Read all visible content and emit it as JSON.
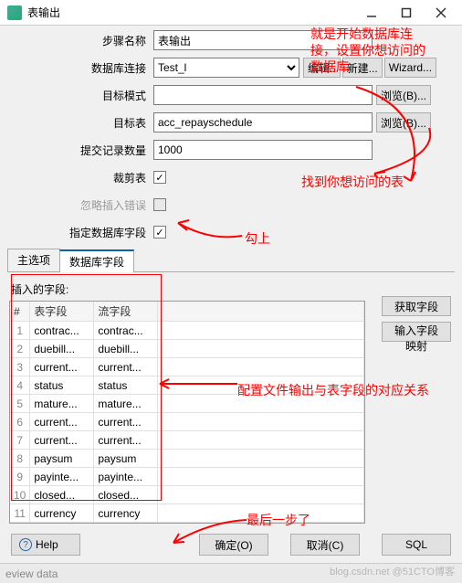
{
  "window": {
    "title": "表输出"
  },
  "form": {
    "stepName": {
      "label": "步骤名称",
      "value": "表输出"
    },
    "dbConn": {
      "label": "数据库连接",
      "value": "Test_l",
      "editBtn": "编辑..",
      "newBtn": "新建...",
      "wizardBtn": "Wizard..."
    },
    "targetSchema": {
      "label": "目标模式",
      "value": "",
      "browseBtn": "浏览(B)..."
    },
    "targetTable": {
      "label": "目标表",
      "value": "acc_repayschedule",
      "browseBtn": "浏览(B)..."
    },
    "commitSize": {
      "label": "提交记录数量",
      "value": "1000"
    },
    "truncate": {
      "label": "裁剪表",
      "checked": true
    },
    "ignoreErr": {
      "label": "忽略插入错误",
      "checked": false
    },
    "specifyFields": {
      "label": "指定数据库字段",
      "checked": true
    }
  },
  "tabs": {
    "main": "主选项",
    "fields": "数据库字段"
  },
  "fieldsPanel": {
    "insertLabel": "插入的字段:",
    "getFieldsBtn": "获取字段",
    "mapBtn": "输入字段映射",
    "columns": {
      "num": "#",
      "tableField": "表字段",
      "streamField": "流字段"
    },
    "rows": [
      {
        "n": 1,
        "t": "contrac...",
        "s": "contrac..."
      },
      {
        "n": 2,
        "t": "duebill...",
        "s": "duebill..."
      },
      {
        "n": 3,
        "t": "current...",
        "s": "current..."
      },
      {
        "n": 4,
        "t": "status",
        "s": "status"
      },
      {
        "n": 5,
        "t": "mature...",
        "s": "mature..."
      },
      {
        "n": 6,
        "t": "current...",
        "s": "current..."
      },
      {
        "n": 7,
        "t": "current...",
        "s": "current..."
      },
      {
        "n": 8,
        "t": "paysum",
        "s": "paysum"
      },
      {
        "n": 9,
        "t": "payinte...",
        "s": "payinte..."
      },
      {
        "n": 10,
        "t": "closed...",
        "s": "closed..."
      },
      {
        "n": 11,
        "t": "currency",
        "s": "currency"
      }
    ]
  },
  "buttons": {
    "help": "Help",
    "ok": "确定(O)",
    "cancel": "取消(C)",
    "sql": "SQL"
  },
  "annotations": {
    "a1": "就是开始数据库连\n接，设置你想访问的\n数据库",
    "a2": "找到你想访问的表",
    "a3": "勾上",
    "a4": "配置文件输出与表字段的对应关系",
    "a5": "最后一步了"
  },
  "watermark": "blog.csdn.net @51CTO博客",
  "footer": "eview data"
}
